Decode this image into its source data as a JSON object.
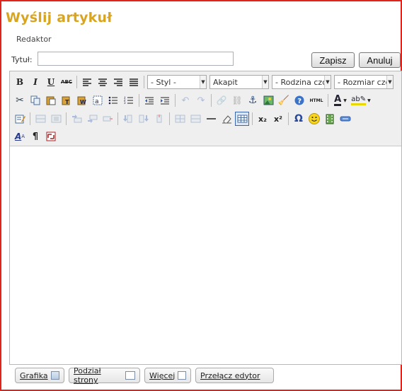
{
  "header": {
    "title": "Wyślij artykuł",
    "subtitle": "Redaktor"
  },
  "form": {
    "title_label": "Tytuł:",
    "title_value": "",
    "title_placeholder": ""
  },
  "buttons": {
    "save": "Zapisz",
    "cancel": "Anuluj"
  },
  "toolbar": {
    "bold": "B",
    "italic": "I",
    "underline": "U",
    "strike": "ABC",
    "style_select": "- Styl -",
    "format_select": "Akapit",
    "font_family_select": "- Rodzina czcionki -",
    "font_size_select": "- Rozmiar czcionki -",
    "html_label": "HTML",
    "subscript": "x₂",
    "superscript": "x²",
    "omega": "Ω",
    "pilcrow": "¶"
  },
  "bottom": {
    "image": "Grafika",
    "page_break": "Podział strony",
    "more": "Więcej",
    "toggle_editor": "Przełącz edytor"
  },
  "colors": {
    "title": "#d9a521",
    "frame_border": "#e0241c",
    "toolbar_bg": "#efefef"
  }
}
